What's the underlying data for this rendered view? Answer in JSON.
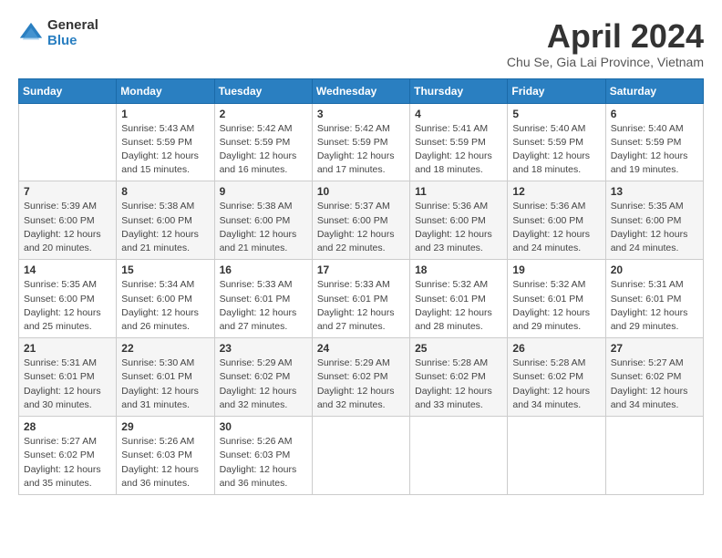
{
  "header": {
    "logo_general": "General",
    "logo_blue": "Blue",
    "month_title": "April 2024",
    "location": "Chu Se, Gia Lai Province, Vietnam"
  },
  "weekdays": [
    "Sunday",
    "Monday",
    "Tuesday",
    "Wednesday",
    "Thursday",
    "Friday",
    "Saturday"
  ],
  "weeks": [
    [
      {
        "day": "",
        "info": ""
      },
      {
        "day": "1",
        "info": "Sunrise: 5:43 AM\nSunset: 5:59 PM\nDaylight: 12 hours\nand 15 minutes."
      },
      {
        "day": "2",
        "info": "Sunrise: 5:42 AM\nSunset: 5:59 PM\nDaylight: 12 hours\nand 16 minutes."
      },
      {
        "day": "3",
        "info": "Sunrise: 5:42 AM\nSunset: 5:59 PM\nDaylight: 12 hours\nand 17 minutes."
      },
      {
        "day": "4",
        "info": "Sunrise: 5:41 AM\nSunset: 5:59 PM\nDaylight: 12 hours\nand 18 minutes."
      },
      {
        "day": "5",
        "info": "Sunrise: 5:40 AM\nSunset: 5:59 PM\nDaylight: 12 hours\nand 18 minutes."
      },
      {
        "day": "6",
        "info": "Sunrise: 5:40 AM\nSunset: 5:59 PM\nDaylight: 12 hours\nand 19 minutes."
      }
    ],
    [
      {
        "day": "7",
        "info": "Sunrise: 5:39 AM\nSunset: 6:00 PM\nDaylight: 12 hours\nand 20 minutes."
      },
      {
        "day": "8",
        "info": "Sunrise: 5:38 AM\nSunset: 6:00 PM\nDaylight: 12 hours\nand 21 minutes."
      },
      {
        "day": "9",
        "info": "Sunrise: 5:38 AM\nSunset: 6:00 PM\nDaylight: 12 hours\nand 21 minutes."
      },
      {
        "day": "10",
        "info": "Sunrise: 5:37 AM\nSunset: 6:00 PM\nDaylight: 12 hours\nand 22 minutes."
      },
      {
        "day": "11",
        "info": "Sunrise: 5:36 AM\nSunset: 6:00 PM\nDaylight: 12 hours\nand 23 minutes."
      },
      {
        "day": "12",
        "info": "Sunrise: 5:36 AM\nSunset: 6:00 PM\nDaylight: 12 hours\nand 24 minutes."
      },
      {
        "day": "13",
        "info": "Sunrise: 5:35 AM\nSunset: 6:00 PM\nDaylight: 12 hours\nand 24 minutes."
      }
    ],
    [
      {
        "day": "14",
        "info": "Sunrise: 5:35 AM\nSunset: 6:00 PM\nDaylight: 12 hours\nand 25 minutes."
      },
      {
        "day": "15",
        "info": "Sunrise: 5:34 AM\nSunset: 6:00 PM\nDaylight: 12 hours\nand 26 minutes."
      },
      {
        "day": "16",
        "info": "Sunrise: 5:33 AM\nSunset: 6:01 PM\nDaylight: 12 hours\nand 27 minutes."
      },
      {
        "day": "17",
        "info": "Sunrise: 5:33 AM\nSunset: 6:01 PM\nDaylight: 12 hours\nand 27 minutes."
      },
      {
        "day": "18",
        "info": "Sunrise: 5:32 AM\nSunset: 6:01 PM\nDaylight: 12 hours\nand 28 minutes."
      },
      {
        "day": "19",
        "info": "Sunrise: 5:32 AM\nSunset: 6:01 PM\nDaylight: 12 hours\nand 29 minutes."
      },
      {
        "day": "20",
        "info": "Sunrise: 5:31 AM\nSunset: 6:01 PM\nDaylight: 12 hours\nand 29 minutes."
      }
    ],
    [
      {
        "day": "21",
        "info": "Sunrise: 5:31 AM\nSunset: 6:01 PM\nDaylight: 12 hours\nand 30 minutes."
      },
      {
        "day": "22",
        "info": "Sunrise: 5:30 AM\nSunset: 6:01 PM\nDaylight: 12 hours\nand 31 minutes."
      },
      {
        "day": "23",
        "info": "Sunrise: 5:29 AM\nSunset: 6:02 PM\nDaylight: 12 hours\nand 32 minutes."
      },
      {
        "day": "24",
        "info": "Sunrise: 5:29 AM\nSunset: 6:02 PM\nDaylight: 12 hours\nand 32 minutes."
      },
      {
        "day": "25",
        "info": "Sunrise: 5:28 AM\nSunset: 6:02 PM\nDaylight: 12 hours\nand 33 minutes."
      },
      {
        "day": "26",
        "info": "Sunrise: 5:28 AM\nSunset: 6:02 PM\nDaylight: 12 hours\nand 34 minutes."
      },
      {
        "day": "27",
        "info": "Sunrise: 5:27 AM\nSunset: 6:02 PM\nDaylight: 12 hours\nand 34 minutes."
      }
    ],
    [
      {
        "day": "28",
        "info": "Sunrise: 5:27 AM\nSunset: 6:02 PM\nDaylight: 12 hours\nand 35 minutes."
      },
      {
        "day": "29",
        "info": "Sunrise: 5:26 AM\nSunset: 6:03 PM\nDaylight: 12 hours\nand 36 minutes."
      },
      {
        "day": "30",
        "info": "Sunrise: 5:26 AM\nSunset: 6:03 PM\nDaylight: 12 hours\nand 36 minutes."
      },
      {
        "day": "",
        "info": ""
      },
      {
        "day": "",
        "info": ""
      },
      {
        "day": "",
        "info": ""
      },
      {
        "day": "",
        "info": ""
      }
    ]
  ]
}
